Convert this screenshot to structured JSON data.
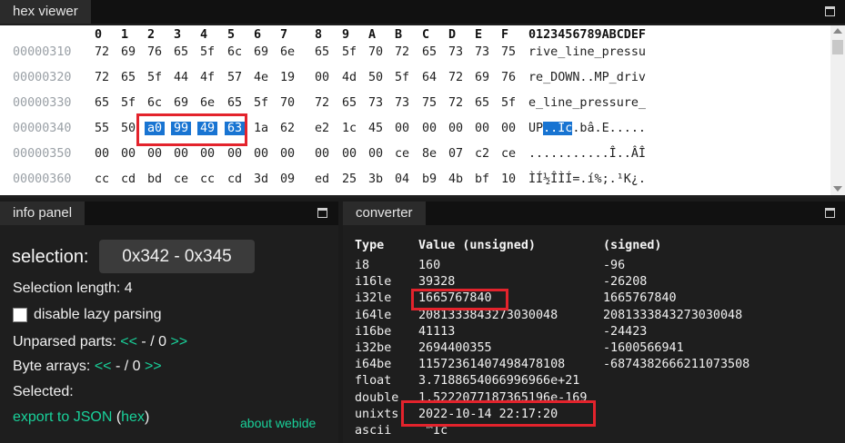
{
  "hex_viewer": {
    "tab_label": "hex viewer",
    "header_bytes": [
      "0",
      "1",
      "2",
      "3",
      "4",
      "5",
      "6",
      "7",
      "8",
      "9",
      "A",
      "B",
      "C",
      "D",
      "E",
      "F"
    ],
    "header_ascii": "0123456789ABCDEF",
    "rows": [
      {
        "offset": "00000310",
        "bytes": [
          "72",
          "69",
          "76",
          "65",
          "5f",
          "6c",
          "69",
          "6e",
          "65",
          "5f",
          "70",
          "72",
          "65",
          "73",
          "73",
          "75"
        ],
        "ascii_pre": "rive_line_pressu",
        "ascii_sel": "",
        "ascii_post": ""
      },
      {
        "offset": "00000320",
        "bytes": [
          "72",
          "65",
          "5f",
          "44",
          "4f",
          "57",
          "4e",
          "19",
          "00",
          "4d",
          "50",
          "5f",
          "64",
          "72",
          "69",
          "76"
        ],
        "ascii_pre": "re_DOWN..MP_driv",
        "ascii_sel": "",
        "ascii_post": ""
      },
      {
        "offset": "00000330",
        "bytes": [
          "65",
          "5f",
          "6c",
          "69",
          "6e",
          "65",
          "5f",
          "70",
          "72",
          "65",
          "73",
          "73",
          "75",
          "72",
          "65",
          "5f"
        ],
        "ascii_pre": "e_line_pressure_",
        "ascii_sel": "",
        "ascii_post": ""
      },
      {
        "offset": "00000340",
        "bytes": [
          "55",
          "50",
          "a0",
          "99",
          "49",
          "63",
          "1a",
          "62",
          "e2",
          "1c",
          "45",
          "00",
          "00",
          "00",
          "00",
          "00"
        ],
        "ascii_pre": "UP",
        "ascii_sel": "..Ic",
        "ascii_post": ".bâ.E.....",
        "selected": [
          2,
          3,
          4,
          5
        ]
      },
      {
        "offset": "00000350",
        "bytes": [
          "00",
          "00",
          "00",
          "00",
          "00",
          "00",
          "00",
          "00",
          "00",
          "00",
          "00",
          "ce",
          "8e",
          "07",
          "c2",
          "ce"
        ],
        "ascii_pre": "...........Î..ÂÎ",
        "ascii_sel": "",
        "ascii_post": ""
      },
      {
        "offset": "00000360",
        "bytes": [
          "cc",
          "cd",
          "bd",
          "ce",
          "cc",
          "cd",
          "3d",
          "09",
          "ed",
          "25",
          "3b",
          "04",
          "b9",
          "4b",
          "bf",
          "10"
        ],
        "ascii_pre": "ÌÍ½ÎÌÍ=.í%;.¹K¿.",
        "ascii_sel": "",
        "ascii_post": ""
      }
    ]
  },
  "info_panel": {
    "tab_label": "info panel",
    "selection_label": "selection:",
    "selection_value": "0x342  -  0x345",
    "selection_length": "Selection length: 4",
    "disable_lazy": "disable lazy parsing",
    "unparsed_label": "Unparsed parts:",
    "unparsed_prev": "<<",
    "unparsed_count": " - / 0 ",
    "unparsed_next": ">>",
    "bytearrays_label": "Byte arrays:",
    "bytearrays_prev": "<<",
    "bytearrays_count": " - / 0 ",
    "bytearrays_next": ">>",
    "selected_label": "Selected:",
    "export_json": "export to JSON",
    "paren_open": " (",
    "export_hex": "hex",
    "paren_close": ")",
    "about": "about webide"
  },
  "converter": {
    "tab_label": "converter",
    "headers": {
      "type": "Type",
      "unsigned": "Value (unsigned)",
      "signed": "(signed)"
    },
    "rows": [
      {
        "type": "i8",
        "unsigned": "160",
        "signed": "-96"
      },
      {
        "type": "i16le",
        "unsigned": "39328",
        "signed": "-26208"
      },
      {
        "type": "i32le",
        "unsigned": "1665767840",
        "signed": "1665767840"
      },
      {
        "type": "i64le",
        "unsigned": "2081333843273030048",
        "signed": "2081333843273030048"
      },
      {
        "type": "i16be",
        "unsigned": "41113",
        "signed": "-24423"
      },
      {
        "type": "i32be",
        "unsigned": "2694400355",
        "signed": "-1600566941"
      },
      {
        "type": "i64be",
        "unsigned": "11572361407498478108",
        "signed": "-6874382666211073508"
      },
      {
        "type": "float",
        "unsigned": "3.7188654066996966e+21",
        "signed": ""
      },
      {
        "type": "double",
        "unsigned": "1.5222077187365196e-169",
        "signed": ""
      },
      {
        "type": "unixts",
        "unsigned": "2022-10-14 22:17:20",
        "signed": ""
      },
      {
        "type": "ascii",
        "unsigned": " ™Ic",
        "signed": ""
      }
    ]
  },
  "colors": {
    "selection": "#1874d2",
    "link": "#19d19a",
    "highlight_box": "#e3232c"
  }
}
